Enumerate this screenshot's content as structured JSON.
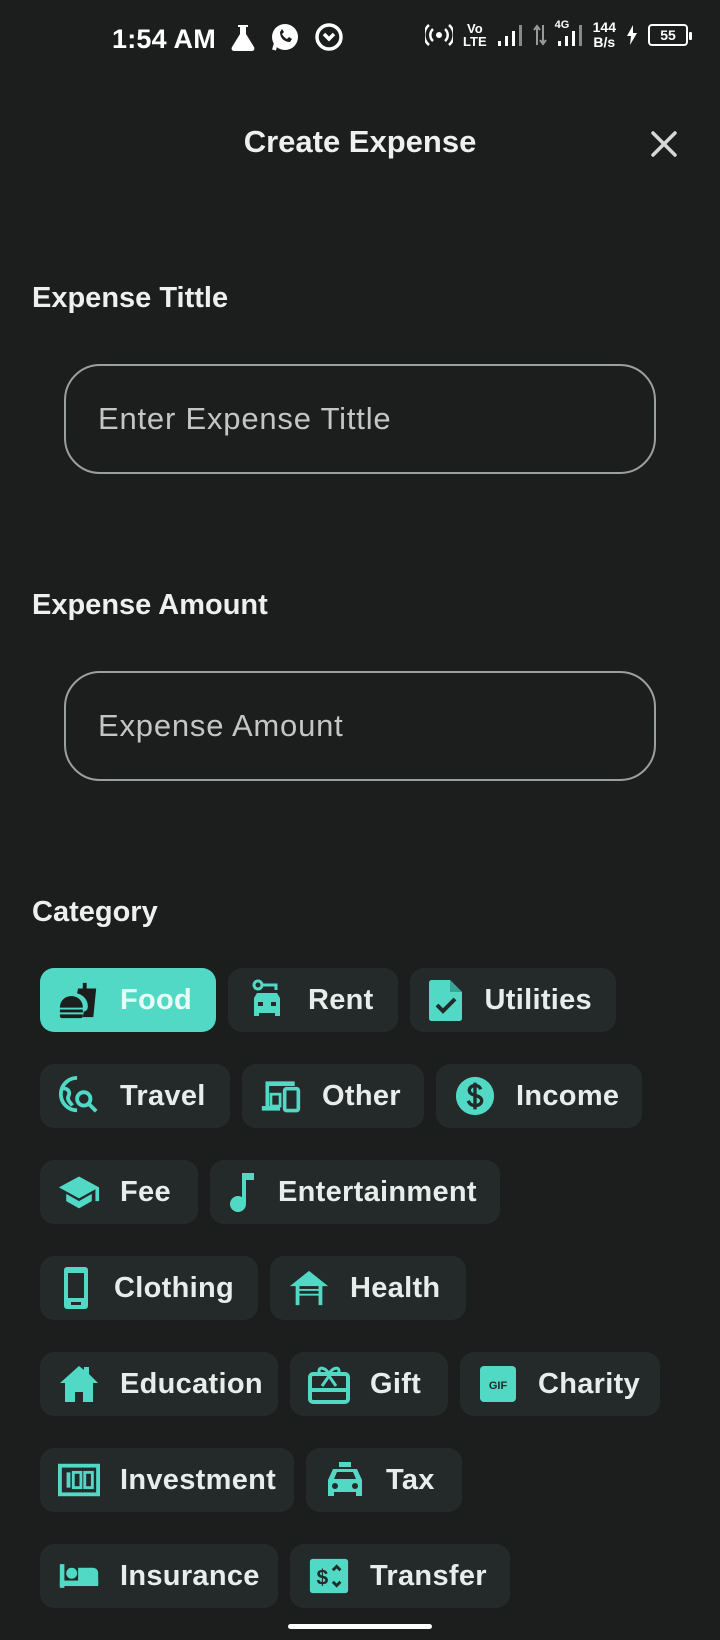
{
  "status_bar": {
    "time": "1:54 AM",
    "network_volte_top": "Vo",
    "network_volte_bottom": "LTE",
    "network_4g": "4G",
    "speed_top": "144",
    "speed_bottom": "B/s",
    "battery_level": "55"
  },
  "header": {
    "title": "Create Expense"
  },
  "form": {
    "title_label": "Expense Tittle",
    "title_placeholder": "Enter Expense Tittle",
    "amount_label": "Expense Amount",
    "amount_placeholder": "Expense Amount",
    "category_label": "Category"
  },
  "colors": {
    "accent": "#52d9c6",
    "chip_bg": "#232a29",
    "background": "#1c1d1d"
  },
  "categories": [
    {
      "label": "Food",
      "icon": "fastfood-icon",
      "selected": true
    },
    {
      "label": "Rent",
      "icon": "car-rental-icon",
      "selected": false
    },
    {
      "label": "Utilities",
      "icon": "document-check-icon",
      "selected": false
    },
    {
      "label": "Travel",
      "icon": "travel-explore-icon",
      "selected": false
    },
    {
      "label": "Other",
      "icon": "devices-icon",
      "selected": false
    },
    {
      "label": "Income",
      "icon": "dollar-circle-icon",
      "selected": false
    },
    {
      "label": "Fee",
      "icon": "school-icon",
      "selected": false
    },
    {
      "label": "Entertainment",
      "icon": "music-note-icon",
      "selected": false
    },
    {
      "label": "Clothing",
      "icon": "phone-icon",
      "selected": false
    },
    {
      "label": "Health",
      "icon": "house-siding-icon",
      "selected": false
    },
    {
      "label": "Education",
      "icon": "home-icon",
      "selected": false
    },
    {
      "label": "Gift",
      "icon": "gift-card-icon",
      "selected": false
    },
    {
      "label": "Charity",
      "icon": "gif-icon",
      "selected": false
    },
    {
      "label": "Investment",
      "icon": "money-icon",
      "selected": false
    },
    {
      "label": "Tax",
      "icon": "taxi-icon",
      "selected": false
    },
    {
      "label": "Insurance",
      "icon": "hotel-icon",
      "selected": false
    },
    {
      "label": "Transfer",
      "icon": "currency-exchange-icon",
      "selected": false
    }
  ]
}
